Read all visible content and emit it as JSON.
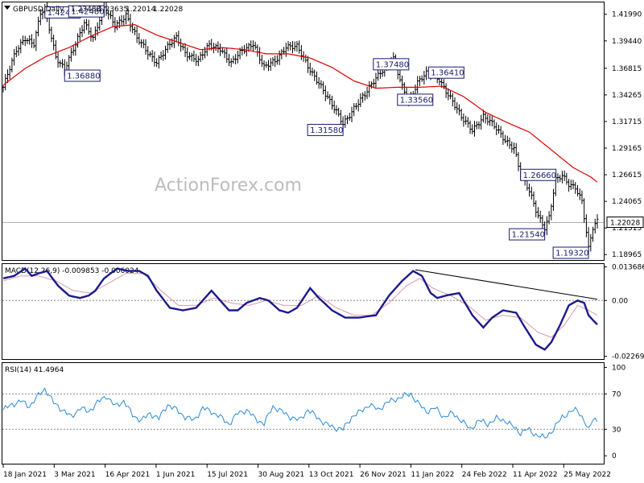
{
  "chart_data": [
    {
      "type": "candlestick",
      "symbol_line": "GBPUSD,Daily",
      "ohlc": {
        "open": "1.23488",
        "high": "1.23635",
        "low": "1.22014",
        "close": "1.22028"
      },
      "watermark": "ActionForex.com",
      "y_ticks": [
        "1.41990",
        "1.39440",
        "1.36815",
        "1.34265",
        "1.31715",
        "1.29165",
        "1.26615",
        "1.24065",
        "1.21515",
        "1.18965"
      ],
      "ylim": [
        1.1852,
        1.4305
      ],
      "current_price": "1.22028",
      "colors": {
        "bars": "#000000",
        "ma": "#e00000",
        "price_line": "#b0b0b0",
        "annotation_border": "#1a1a6e"
      },
      "price_path": [
        [
          0,
          1.35
        ],
        [
          6,
          1.385
        ],
        [
          10,
          1.398
        ],
        [
          14,
          1.392
        ],
        [
          17,
          1.42
        ],
        [
          19,
          1.424
        ],
        [
          24,
          1.38
        ],
        [
          28,
          1.368
        ],
        [
          33,
          1.39
        ],
        [
          37,
          1.412
        ],
        [
          41,
          1.398
        ],
        [
          44,
          1.415
        ],
        [
          46,
          1.425
        ],
        [
          51,
          1.409
        ],
        [
          56,
          1.42
        ],
        [
          61,
          1.396
        ],
        [
          66,
          1.383
        ],
        [
          70,
          1.375
        ],
        [
          75,
          1.388
        ],
        [
          79,
          1.397
        ],
        [
          83,
          1.384
        ],
        [
          89,
          1.375
        ],
        [
          94,
          1.39
        ],
        [
          99,
          1.388
        ],
        [
          104,
          1.372
        ],
        [
          109,
          1.385
        ],
        [
          114,
          1.393
        ],
        [
          119,
          1.368
        ],
        [
          124,
          1.375
        ],
        [
          129,
          1.39
        ],
        [
          134,
          1.388
        ],
        [
          139,
          1.37
        ],
        [
          144,
          1.355
        ],
        [
          149,
          1.335
        ],
        [
          152,
          1.326
        ],
        [
          155,
          1.316
        ],
        [
          160,
          1.33
        ],
        [
          165,
          1.342
        ],
        [
          170,
          1.36
        ],
        [
          174,
          1.37
        ],
        [
          178,
          1.376
        ],
        [
          182,
          1.35
        ],
        [
          185,
          1.337
        ],
        [
          189,
          1.355
        ],
        [
          194,
          1.364
        ],
        [
          199,
          1.358
        ],
        [
          204,
          1.34
        ],
        [
          209,
          1.32
        ],
        [
          214,
          1.31
        ],
        [
          219,
          1.322
        ],
        [
          224,
          1.312
        ],
        [
          229,
          1.3
        ],
        [
          233,
          1.292
        ],
        [
          236,
          1.266
        ],
        [
          240,
          1.25
        ],
        [
          244,
          1.228
        ],
        [
          247,
          1.216
        ],
        [
          249,
          1.225
        ],
        [
          252,
          1.26
        ],
        [
          255,
          1.265
        ],
        [
          258,
          1.258
        ],
        [
          261,
          1.255
        ],
        [
          264,
          1.24
        ],
        [
          266,
          1.21
        ],
        [
          267,
          1.194
        ],
        [
          269,
          1.215
        ],
        [
          271,
          1.222
        ]
      ],
      "ma_path": [
        [
          0,
          1.352
        ],
        [
          10,
          1.368
        ],
        [
          20,
          1.38
        ],
        [
          30,
          1.388
        ],
        [
          40,
          1.399
        ],
        [
          50,
          1.408
        ],
        [
          60,
          1.41
        ],
        [
          70,
          1.4
        ],
        [
          80,
          1.393
        ],
        [
          90,
          1.386
        ],
        [
          100,
          1.388
        ],
        [
          110,
          1.386
        ],
        [
          120,
          1.382
        ],
        [
          130,
          1.382
        ],
        [
          140,
          1.378
        ],
        [
          150,
          1.369
        ],
        [
          160,
          1.356
        ],
        [
          170,
          1.349
        ],
        [
          180,
          1.35
        ],
        [
          190,
          1.35
        ],
        [
          200,
          1.351
        ],
        [
          210,
          1.341
        ],
        [
          220,
          1.326
        ],
        [
          230,
          1.316
        ],
        [
          240,
          1.307
        ],
        [
          250,
          1.29
        ],
        [
          260,
          1.273
        ],
        [
          268,
          1.264
        ],
        [
          271,
          1.259
        ]
      ],
      "annotations": [
        {
          "label": "1.42400",
          "x": 19,
          "y": 1.424,
          "anchor": "left",
          "vpos": "top"
        },
        {
          "label": "1.36880",
          "x": 28,
          "y": 1.368,
          "anchor": "left",
          "vpos": "bottom"
        },
        {
          "label": "1.42480",
          "x": 46,
          "y": 1.425,
          "anchor": "right",
          "vpos": "top"
        },
        {
          "label": "1.37480",
          "x": 185,
          "y": 1.372,
          "anchor": "right",
          "vpos": "center"
        },
        {
          "label": "1.36410",
          "x": 194,
          "y": 1.364,
          "anchor": "left",
          "vpos": "center"
        },
        {
          "label": "1.33560",
          "x": 196,
          "y": 1.338,
          "anchor": "right",
          "vpos": "center"
        },
        {
          "label": "1.31580",
          "x": 155,
          "y": 1.316,
          "anchor": "right",
          "vpos": "bottom"
        },
        {
          "label": "1.26660",
          "x": 236,
          "y": 1.266,
          "anchor": "left",
          "vpos": "center"
        },
        {
          "label": "1.21540",
          "x": 247,
          "y": 1.216,
          "anchor": "right",
          "vpos": "bottom"
        },
        {
          "label": "1.19320",
          "x": 267,
          "y": 1.194,
          "anchor": "right",
          "vpos": "bottom"
        }
      ]
    },
    {
      "type": "line",
      "title": "MACD(12,26,9) -0.009853 -0.006024",
      "y_ticks": [
        "0.013686",
        "0.00",
        "-0.022698"
      ],
      "ylim": [
        -0.0235,
        0.0145
      ],
      "colors": {
        "macd": "#1a1a8c",
        "signal": "#d79aa8",
        "trendline": "#000000",
        "zero": "#888888"
      },
      "trendline": [
        [
          188,
          0.0125
        ],
        [
          271,
          0.0005
        ]
      ],
      "macd": [
        [
          0,
          0.009
        ],
        [
          5,
          0.01
        ],
        [
          10,
          0.013
        ],
        [
          13,
          0.01
        ],
        [
          16,
          0.011
        ],
        [
          20,
          0.012
        ],
        [
          25,
          0.006
        ],
        [
          30,
          0.002
        ],
        [
          35,
          0.001
        ],
        [
          39,
          0.002
        ],
        [
          42,
          0.004
        ],
        [
          46,
          0.009
        ],
        [
          52,
          0.013
        ],
        [
          57,
          0.012
        ],
        [
          62,
          0.012
        ],
        [
          66,
          0.01
        ],
        [
          70,
          0.004
        ],
        [
          76,
          -0.003
        ],
        [
          82,
          -0.004
        ],
        [
          88,
          -0.003
        ],
        [
          95,
          0.004
        ],
        [
          103,
          -0.004
        ],
        [
          107,
          -0.004
        ],
        [
          111,
          -0.001
        ],
        [
          117,
          0.001
        ],
        [
          121,
          0.0
        ],
        [
          126,
          -0.004
        ],
        [
          130,
          -0.005
        ],
        [
          134,
          -0.003
        ],
        [
          140,
          0.005
        ],
        [
          144,
          0.001
        ],
        [
          150,
          -0.004
        ],
        [
          156,
          -0.007
        ],
        [
          162,
          -0.007
        ],
        [
          170,
          -0.006
        ],
        [
          176,
          0.002
        ],
        [
          182,
          0.008
        ],
        [
          187,
          0.012
        ],
        [
          191,
          0.01
        ],
        [
          195,
          0.003
        ],
        [
          198,
          0.001
        ],
        [
          202,
          0.002
        ],
        [
          208,
          0.003
        ],
        [
          214,
          -0.006
        ],
        [
          219,
          -0.011
        ],
        [
          223,
          -0.007
        ],
        [
          228,
          -0.004
        ],
        [
          234,
          -0.005
        ],
        [
          238,
          -0.011
        ],
        [
          243,
          -0.018
        ],
        [
          247,
          -0.02
        ],
        [
          250,
          -0.017
        ],
        [
          254,
          -0.01
        ],
        [
          258,
          -0.002
        ],
        [
          262,
          0.0
        ],
        [
          265,
          -0.001
        ],
        [
          267,
          -0.006
        ],
        [
          269,
          -0.008
        ],
        [
          271,
          -0.0098
        ]
      ],
      "signal": [
        [
          0,
          0.008
        ],
        [
          8,
          0.01
        ],
        [
          16,
          0.01
        ],
        [
          24,
          0.008
        ],
        [
          32,
          0.004
        ],
        [
          40,
          0.003
        ],
        [
          48,
          0.007
        ],
        [
          56,
          0.011
        ],
        [
          64,
          0.011
        ],
        [
          72,
          0.004
        ],
        [
          80,
          -0.002
        ],
        [
          88,
          -0.002
        ],
        [
          96,
          0.001
        ],
        [
          104,
          -0.001
        ],
        [
          112,
          -0.002
        ],
        [
          120,
          0.0
        ],
        [
          128,
          -0.002
        ],
        [
          136,
          -0.002
        ],
        [
          144,
          0.002
        ],
        [
          152,
          -0.003
        ],
        [
          160,
          -0.006
        ],
        [
          168,
          -0.006
        ],
        [
          176,
          -0.001
        ],
        [
          184,
          0.006
        ],
        [
          190,
          0.009
        ],
        [
          196,
          0.005
        ],
        [
          204,
          0.002
        ],
        [
          212,
          -0.002
        ],
        [
          220,
          -0.008
        ],
        [
          228,
          -0.006
        ],
        [
          236,
          -0.007
        ],
        [
          244,
          -0.013
        ],
        [
          250,
          -0.015
        ],
        [
          256,
          -0.01
        ],
        [
          262,
          -0.002
        ],
        [
          267,
          -0.004
        ],
        [
          271,
          -0.006
        ]
      ]
    },
    {
      "type": "line",
      "title": "RSI(14) 41.4964",
      "y_ticks": [
        "100",
        "70",
        "30",
        "0"
      ],
      "ylim": [
        -8,
        104
      ],
      "levels": [
        70,
        30
      ],
      "colors": {
        "rsi": "#2a8ad8",
        "levels": "#888888"
      },
      "rsi": [
        [
          0,
          52
        ],
        [
          4,
          58
        ],
        [
          8,
          62
        ],
        [
          12,
          56
        ],
        [
          16,
          68
        ],
        [
          19,
          76
        ],
        [
          23,
          60
        ],
        [
          27,
          52
        ],
        [
          31,
          44
        ],
        [
          35,
          54
        ],
        [
          39,
          50
        ],
        [
          43,
          60
        ],
        [
          47,
          68
        ],
        [
          51,
          56
        ],
        [
          55,
          62
        ],
        [
          59,
          46
        ],
        [
          63,
          40
        ],
        [
          67,
          48
        ],
        [
          71,
          42
        ],
        [
          75,
          58
        ],
        [
          79,
          52
        ],
        [
          83,
          44
        ],
        [
          87,
          40
        ],
        [
          91,
          54
        ],
        [
          95,
          50
        ],
        [
          99,
          44
        ],
        [
          103,
          36
        ],
        [
          107,
          48
        ],
        [
          111,
          52
        ],
        [
          115,
          42
        ],
        [
          119,
          36
        ],
        [
          123,
          56
        ],
        [
          127,
          50
        ],
        [
          131,
          44
        ],
        [
          135,
          40
        ],
        [
          139,
          52
        ],
        [
          143,
          44
        ],
        [
          147,
          36
        ],
        [
          151,
          32
        ],
        [
          155,
          30
        ],
        [
          159,
          44
        ],
        [
          163,
          50
        ],
        [
          167,
          58
        ],
        [
          171,
          52
        ],
        [
          175,
          60
        ],
        [
          179,
          64
        ],
        [
          183,
          68
        ],
        [
          186,
          70
        ],
        [
          189,
          60
        ],
        [
          193,
          50
        ],
        [
          197,
          54
        ],
        [
          201,
          44
        ],
        [
          205,
          48
        ],
        [
          209,
          40
        ],
        [
          213,
          30
        ],
        [
          217,
          40
        ],
        [
          221,
          36
        ],
        [
          225,
          42
        ],
        [
          229,
          40
        ],
        [
          233,
          32
        ],
        [
          236,
          26
        ],
        [
          239,
          30
        ],
        [
          243,
          24
        ],
        [
          247,
          20
        ],
        [
          251,
          30
        ],
        [
          255,
          44
        ],
        [
          259,
          50
        ],
        [
          262,
          52
        ],
        [
          265,
          40
        ],
        [
          267,
          28
        ],
        [
          269,
          42
        ],
        [
          271,
          41
        ]
      ]
    }
  ],
  "x_axis_labels": [
    "18 Jan 2021",
    "3 Mar 2021",
    "16 Apr 2021",
    "1 Jun 2021",
    "15 Jul 2021",
    "30 Aug 2021",
    "13 Oct 2021",
    "26 Nov 2021",
    "11 Jan 2022",
    "24 Feb 2022",
    "11 Apr 2022",
    "25 May 2022"
  ]
}
